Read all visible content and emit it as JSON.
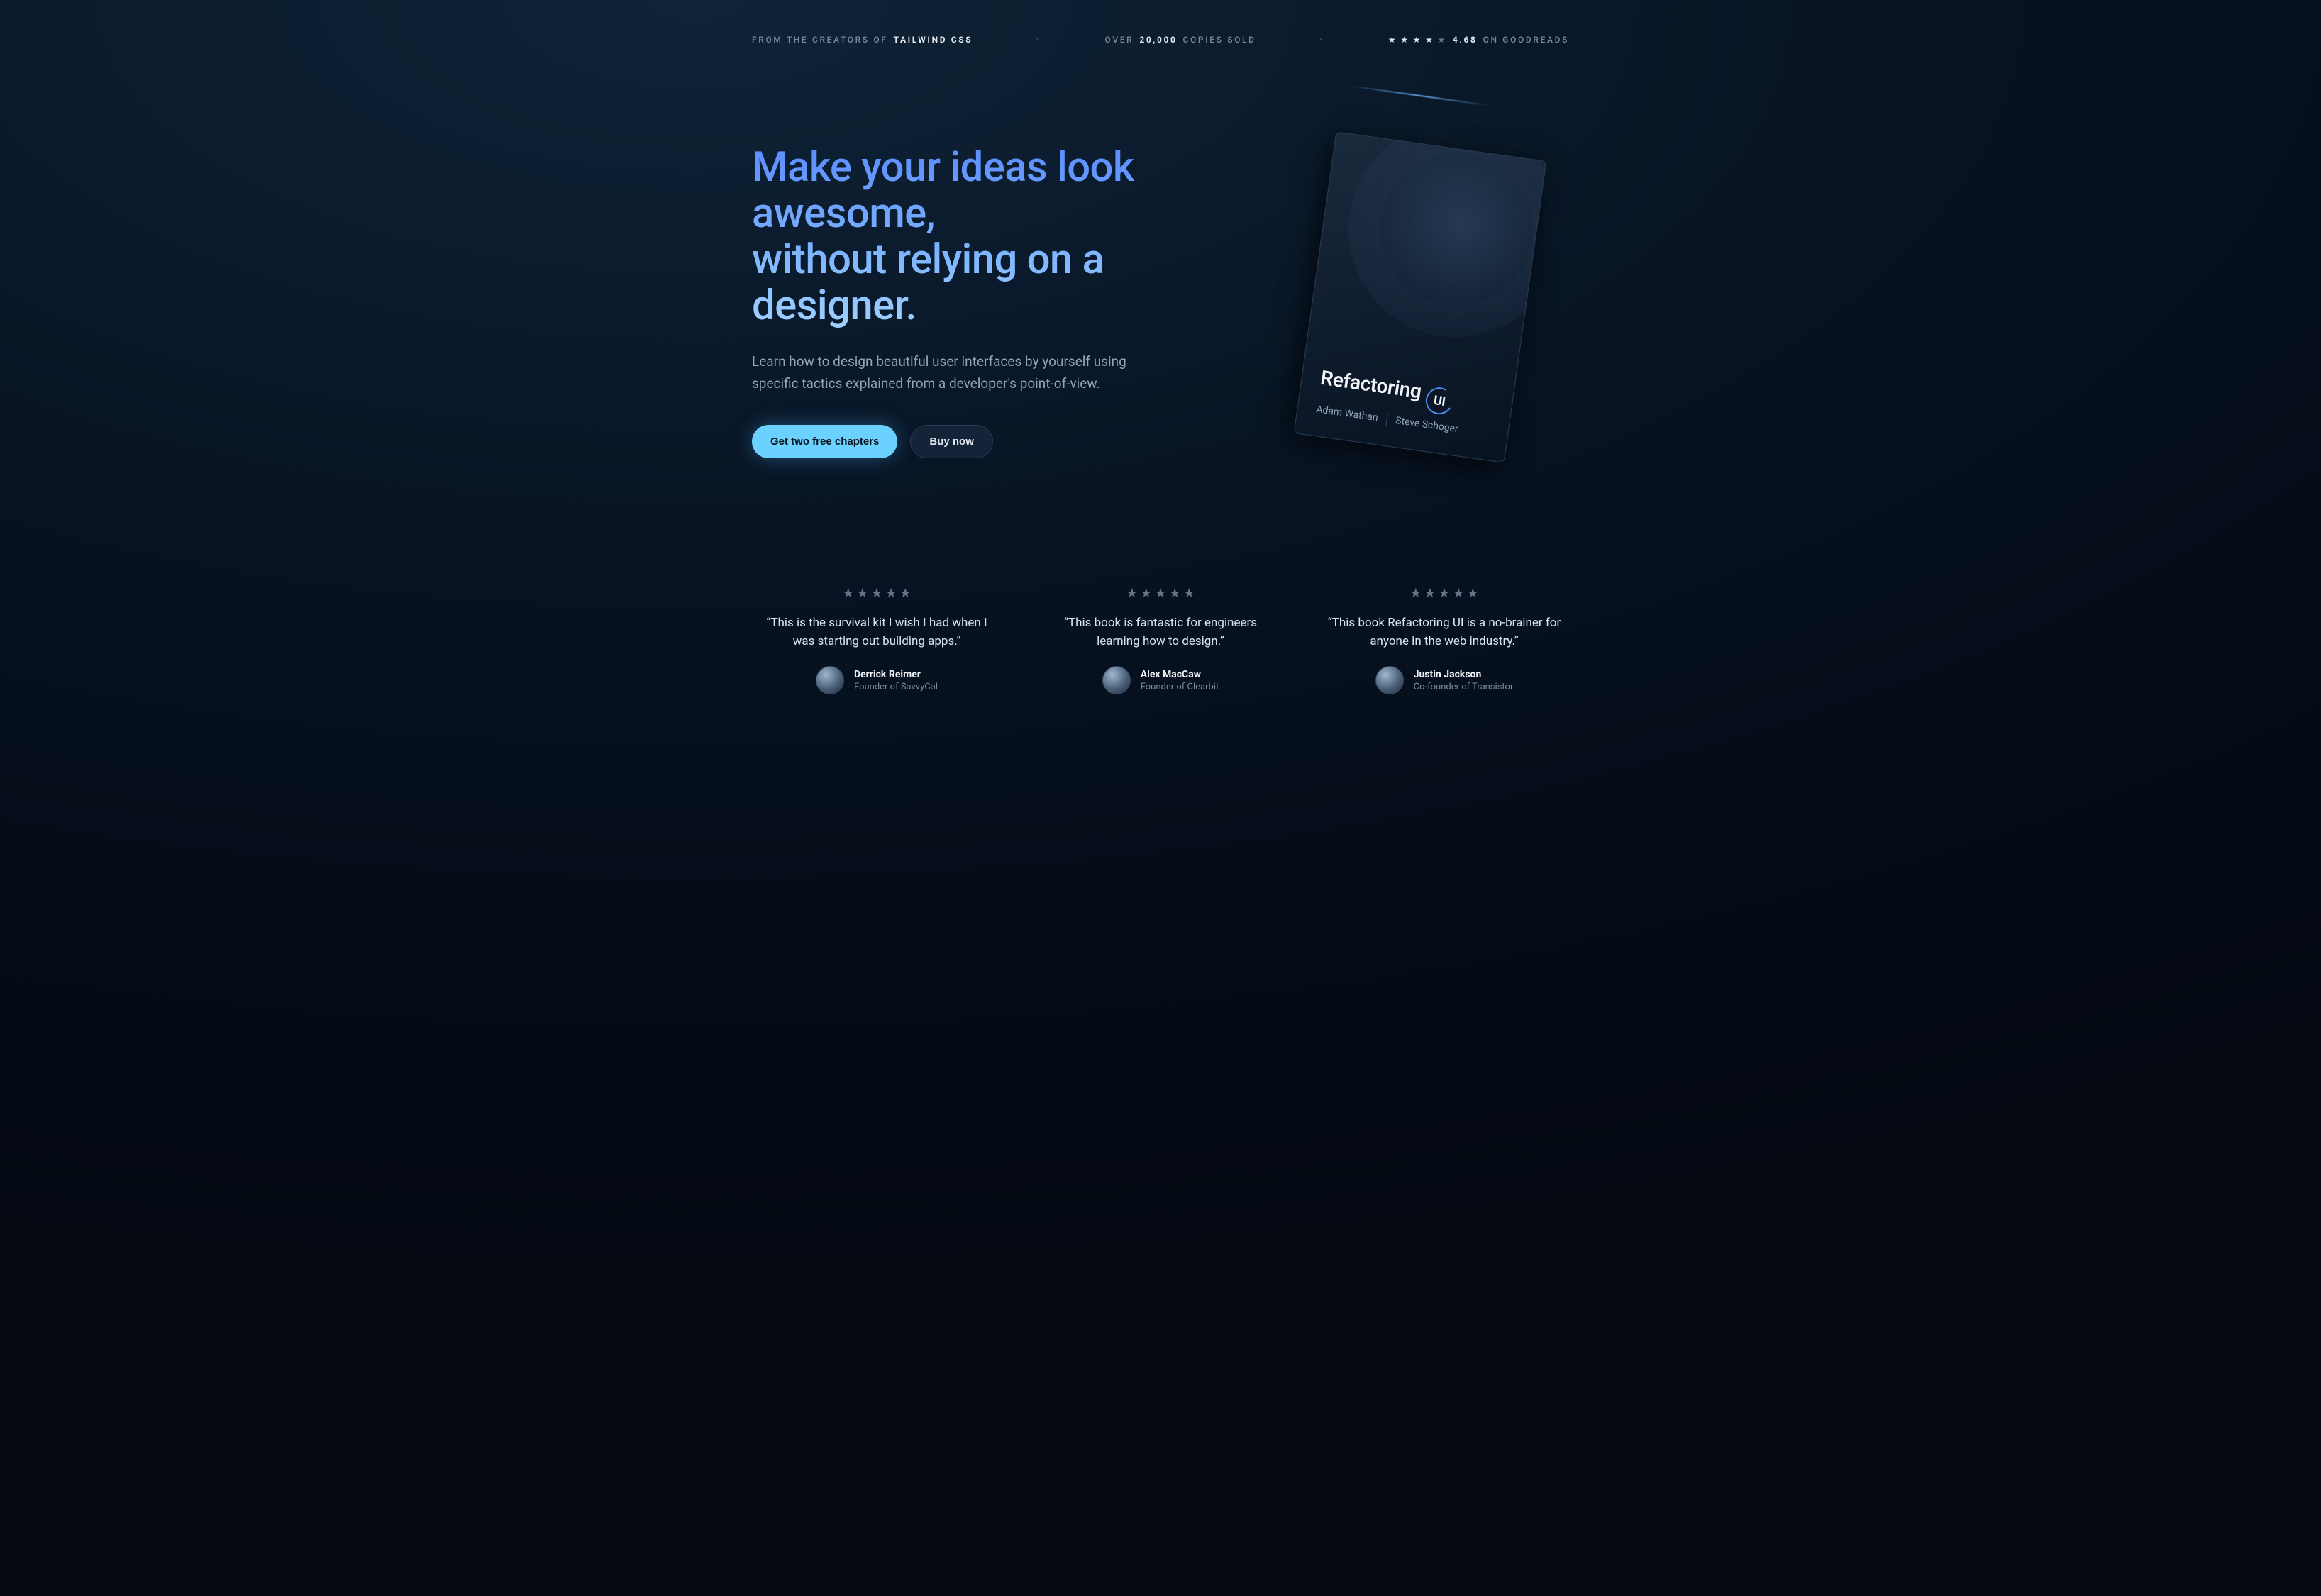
{
  "topbar": {
    "creators_prefix": "FROM THE CREATORS OF ",
    "creators_strong": "TAILWIND CSS",
    "copies_prefix": "OVER ",
    "copies_strong": "20,000",
    "copies_suffix": " COPIES SOLD",
    "rating_value": "4.68",
    "rating_suffix": " ON GOODREADS",
    "rating_stars": 4.5
  },
  "hero": {
    "headline_line1": "Make your ideas look awesome,",
    "headline_line2": "without relying on a designer.",
    "subhead": "Learn how to design beautiful user interfaces by yourself using specific tactics explained from a developer's point-of-view.",
    "cta_primary": "Get two free chapters",
    "cta_secondary": "Buy now"
  },
  "book": {
    "title_word": "Refactoring",
    "title_badge": "UI",
    "author1": "Adam Wathan",
    "author2": "Steve Schoger"
  },
  "testimonials": [
    {
      "quote": "“This is the survival kit I wish I had when I was starting out building apps.”",
      "name": "Derrick Reimer",
      "role": "Founder of SavvyCal"
    },
    {
      "quote": "“This book is fantastic for engineers learning how to design.”",
      "name": "Alex MacCaw",
      "role": "Founder of Clearbit"
    },
    {
      "quote": "“This book Refactoring UI is a no-brainer for anyone in the web industry.”",
      "name": "Justin Jackson",
      "role": "Co-founder of Transistor"
    }
  ]
}
